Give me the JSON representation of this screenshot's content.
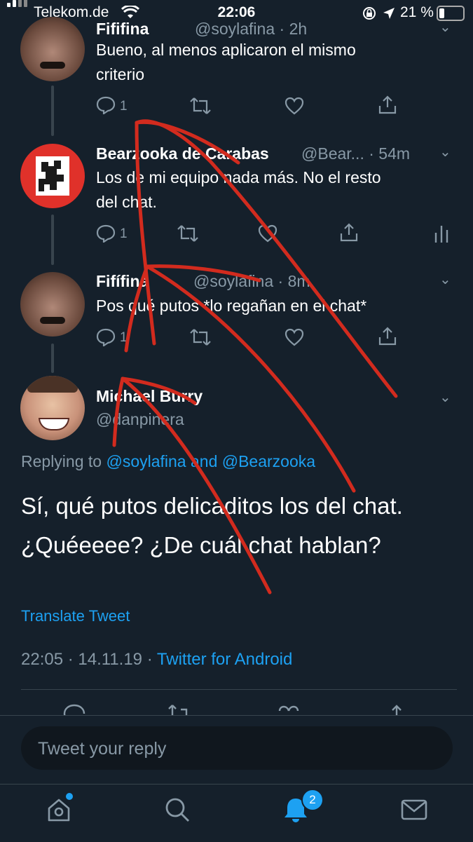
{
  "status_bar": {
    "carrier": "Telekom.de",
    "time": "22:06",
    "battery": "21 %"
  },
  "thread": [
    {
      "name": "Fififina",
      "handle": "@soylafina · 2h",
      "text_lines": [
        "Bueno, al menos aplicaron el mismo",
        "criterio"
      ],
      "reply_count": "1"
    },
    {
      "name": "Bearzooka de Carabas",
      "handle": "@Bear... · 54m",
      "text_lines": [
        "Los de mi equipo nada más. No el resto",
        "del chat."
      ],
      "reply_count": "1"
    },
    {
      "name": "Fifífina",
      "handle": "@soylafina · 8m",
      "text_lines": [
        "Pos qué putos *lo regañan en el chat*"
      ],
      "reply_count": "1"
    }
  ],
  "main_tweet": {
    "name": "Michael Burry",
    "handle": "@danpinera",
    "replying_prefix": "Replying to",
    "replying_to": "@soylafina and @Bearzooka",
    "text_lines": [
      "Sí, qué putos delicaditos los del chat.",
      "¿Quéeeee? ¿De cuál chat hablan?"
    ],
    "translate_label": "Translate Tweet",
    "timestamp": "22:05 · 14.11.19 ·",
    "source": "Twitter for Android"
  },
  "reply_box": {
    "placeholder": "Tweet your reply"
  },
  "bottom_nav": {
    "notifications_badge": "2",
    "icons": [
      "home-icon",
      "search-icon",
      "notifications-icon",
      "messages-icon"
    ]
  },
  "colors": {
    "background": "#15202b",
    "accent": "#1da1f2",
    "secondary_text": "#8899a6",
    "annotation": "#d22b1e",
    "avatar_bearzooka": "#e0312a"
  }
}
